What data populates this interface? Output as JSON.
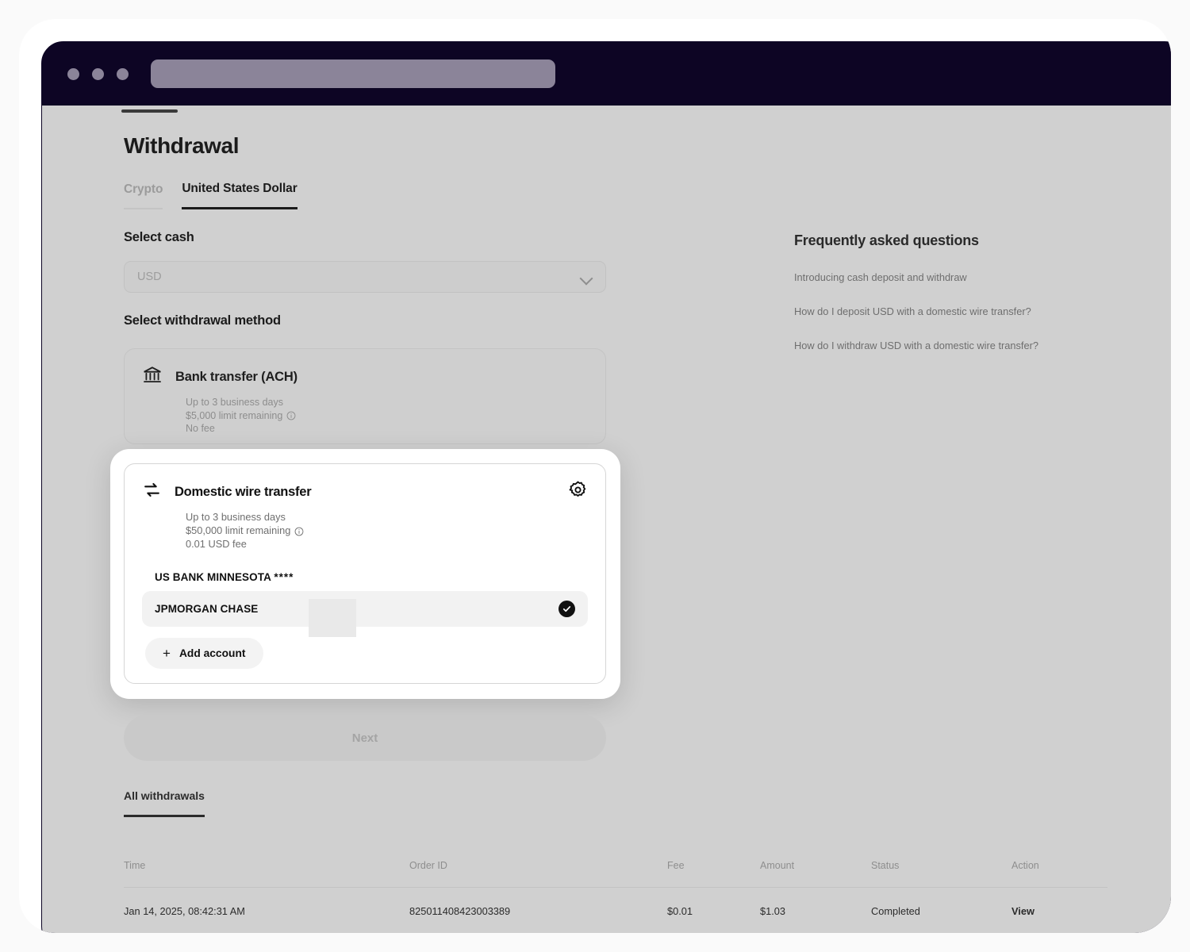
{
  "browser": {
    "url_redacted": true,
    "dots": [
      "close-dot",
      "minimize-dot",
      "maximize-dot"
    ]
  },
  "page": {
    "title": "Withdrawal"
  },
  "currency_tabs": [
    {
      "label": "Crypto",
      "active": false
    },
    {
      "label": "United States Dollar",
      "active": true
    }
  ],
  "select_cash": {
    "label": "Select cash",
    "value": "USD",
    "placeholder": "USD"
  },
  "withdrawal_method": {
    "label": "Select withdrawal method",
    "methods": [
      {
        "icon": "bank-icon",
        "title": "Bank transfer (ACH)",
        "duration": "Up to 3 business days",
        "limit": "$5,000 limit remaining",
        "fee": "No fee",
        "selected": false
      },
      {
        "icon": "transfer-arrows-icon",
        "title": "Domestic wire transfer",
        "duration": "Up to 3 business days",
        "limit": "$50,000 limit remaining",
        "fee": "0.01 USD fee",
        "selected": true
      }
    ]
  },
  "accounts": [
    {
      "name": "US BANK MINNESOTA",
      "mask": "****",
      "selected": false
    },
    {
      "name": "JPMORGAN CHASE",
      "mask": "",
      "selected": true
    }
  ],
  "add_account_label": "Add account",
  "next_label": "Next",
  "faq": {
    "title": "Frequently asked questions",
    "items": [
      "Introducing cash deposit and withdraw",
      "How do I deposit USD with a domestic wire transfer?",
      "How do I withdraw USD with a domestic wire transfer?"
    ]
  },
  "withdrawals": {
    "tab_label": "All withdrawals",
    "columns": [
      "Time",
      "Order ID",
      "Fee",
      "Amount",
      "Status",
      "Action"
    ],
    "rows": [
      {
        "time": "Jan 14, 2025, 08:42:31 AM",
        "order_id": "825011408423003389",
        "fee": "$0.01",
        "amount": "$1.03",
        "status": "Completed",
        "action": "View"
      }
    ]
  },
  "colors": {
    "chrome": "#0d0524",
    "viewport_bg": "#d0d0d0",
    "accent": "#111111",
    "muted_text": "#8d8d8d"
  }
}
